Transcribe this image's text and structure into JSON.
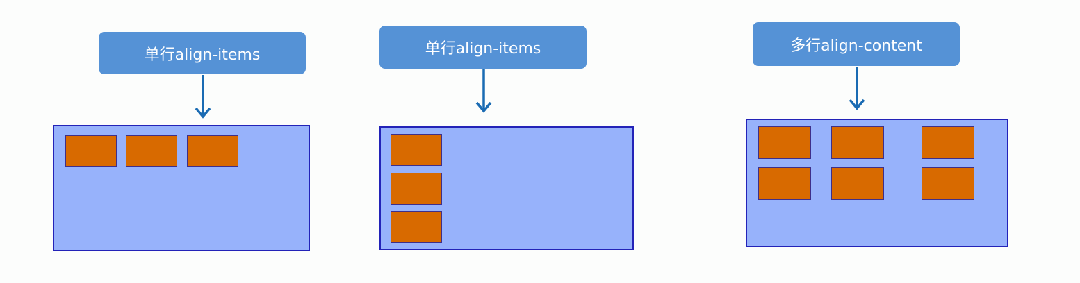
{
  "colors": {
    "background": "#fcfdfc",
    "label_bg": "#5592d6",
    "label_text": "#ffffff",
    "arrow": "#1a6bb3",
    "container_fill": "#97b2fb",
    "container_border": "#2323b8",
    "item_fill": "#d86a00",
    "item_border": "#3e2f8a"
  },
  "panels": [
    {
      "label": "单行align-items",
      "item_count": 3
    },
    {
      "label": "单行align-items",
      "item_count": 3
    },
    {
      "label": "多行align-content",
      "item_count": 6
    }
  ]
}
